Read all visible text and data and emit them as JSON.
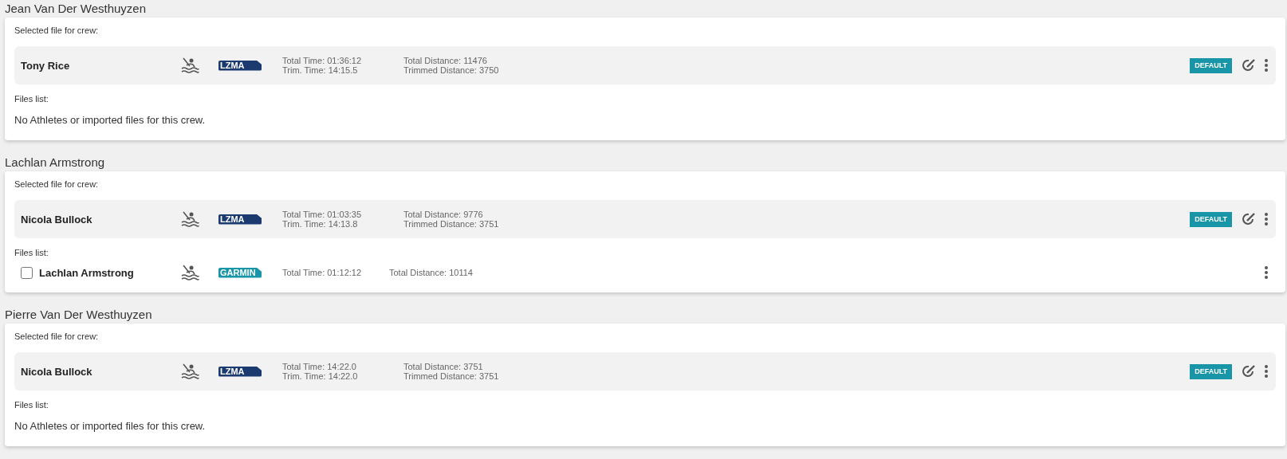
{
  "crews": [
    {
      "name": "Jean Van Der Westhuyzen",
      "selected_label": "Selected file for crew:",
      "selected_file": {
        "athlete": "Tony Rice",
        "source": {
          "kind": "lzma",
          "label": "LZMA"
        },
        "total_time": "Total Time: 01:36:12",
        "trim_time": "Trim. Time: 14:15.5",
        "total_distance": "Total Distance: 11476",
        "trimmed_distance": "Trimmed Distance: 3750",
        "default_label": "DEFAULT"
      },
      "files_label": "Files list:",
      "empty_message": "No Athletes or imported files for this crew."
    },
    {
      "name": "Lachlan Armstrong",
      "selected_label": "Selected file for crew:",
      "selected_file": {
        "athlete": "Nicola Bullock",
        "source": {
          "kind": "lzma",
          "label": "LZMA"
        },
        "total_time": "Total Time: 01:03:35",
        "trim_time": "Trim. Time: 14:13.8",
        "total_distance": "Total Distance: 9776",
        "trimmed_distance": "Trimmed Distance: 3751",
        "default_label": "DEFAULT"
      },
      "files_label": "Files list:",
      "files": [
        {
          "athlete": "Lachlan Armstrong",
          "checked": false,
          "source": {
            "kind": "garmin",
            "label": "GARMIN"
          },
          "total_time": "Total Time: 01:12:12",
          "total_distance": "Total Distance: 10114"
        }
      ]
    },
    {
      "name": "Pierre Van Der Westhuyzen",
      "selected_label": "Selected file for crew:",
      "selected_file": {
        "athlete": "Nicola Bullock",
        "source": {
          "kind": "lzma",
          "label": "LZMA"
        },
        "total_time": "Total Time: 14:22.0",
        "trim_time": "Trim. Time: 14:22.0",
        "total_distance": "Total Distance: 3751",
        "trimmed_distance": "Trimmed Distance: 3751",
        "default_label": "DEFAULT"
      },
      "files_label": "Files list:",
      "empty_message": "No Athletes or imported files for this crew."
    }
  ]
}
